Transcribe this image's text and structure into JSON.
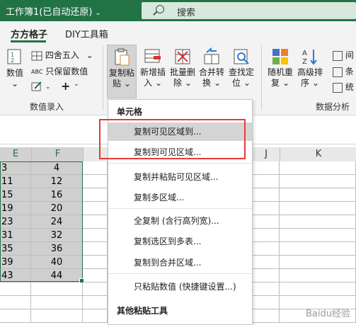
{
  "titlebar": {
    "title": "工作簿1(已自动还原)",
    "dropdown": "⌄",
    "search_label": "搜索"
  },
  "tabs": [
    {
      "label": "方方格子"
    },
    {
      "label": "DIY工具箱"
    }
  ],
  "ribbon": {
    "value_btn": {
      "line1": "数值",
      "line2": "⌄"
    },
    "round": "四舍五入",
    "round_dd": "⌄",
    "keep_value": "只保留数值",
    "plus": "+",
    "copy_paste": {
      "line1": "复制粘",
      "line2": "贴",
      "dd": "⌄"
    },
    "insert": {
      "line1": "新增插",
      "line2": "入",
      "dd": "⌄"
    },
    "batch_delete": {
      "line1": "批量删",
      "line2": "除",
      "dd": "⌄"
    },
    "merge": {
      "line1": "合并转",
      "line2": "换",
      "dd": "⌄"
    },
    "find": {
      "line1": "查找定",
      "line2": "位",
      "dd": "⌄"
    },
    "random": {
      "line1": "随机重",
      "line2": "复",
      "dd": "⌄"
    },
    "sort": {
      "line1": "高级排",
      "line2": "序",
      "dd": "⌄"
    },
    "right_items": [
      "间",
      "条",
      "统"
    ],
    "group_data_entry": "数值录入",
    "group_data_analysis": "数据分析"
  },
  "columns": {
    "e": "E",
    "f": "F",
    "j": "J",
    "k": "K"
  },
  "rows": [
    {
      "e": "3",
      "f": "4"
    },
    {
      "e": "11",
      "f": "12"
    },
    {
      "e": "15",
      "f": "16"
    },
    {
      "e": "19",
      "f": "20"
    },
    {
      "e": "23",
      "f": "24"
    },
    {
      "e": "31",
      "f": "32"
    },
    {
      "e": "35",
      "f": "36"
    },
    {
      "e": "39",
      "f": "40"
    },
    {
      "e": "43",
      "f": "44"
    }
  ],
  "menu": {
    "header1": "单元格",
    "items": [
      "复制可见区域到...",
      "复制到可见区域...",
      "复制并粘贴可见区域...",
      "复制多区域...",
      "全复制 (含行高列宽)...",
      "复制选区到多表...",
      "复制到合并区域...",
      "只粘贴数值 (快捷键设置...)"
    ],
    "header2": "其他粘贴工具"
  },
  "watermark": "Baidu经验",
  "colors": {
    "accent": "#217346",
    "highlight_box": "#e23b3b"
  }
}
